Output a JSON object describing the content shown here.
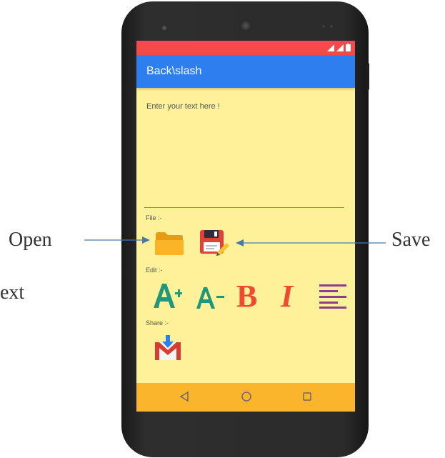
{
  "callouts": {
    "open": "Open",
    "save": "Save",
    "cut_text": "ext"
  },
  "app": {
    "title": "Back\\slash",
    "text_placeholder": "Enter your text here !"
  },
  "sections": {
    "file_label": "File :-",
    "edit_label": "Edit :-",
    "share_label": "Share :-"
  },
  "icons": {
    "file": [
      "open-folder-icon",
      "save-floppy-icon"
    ],
    "edit": [
      "increase-font-size-icon",
      "decrease-font-size-icon",
      "bold-icon",
      "italic-icon",
      "align-text-icon"
    ],
    "share": [
      "gmail-share-icon"
    ],
    "nav": [
      "back-icon",
      "home-icon",
      "recents-icon"
    ]
  },
  "colors": {
    "status_bar": "#f44a4a",
    "app_bar": "#2d7ff0",
    "background": "#fdf199",
    "nav_bar": "#fbb52d",
    "font_size_icons": "#21967a",
    "bold_italic": "#f04a30",
    "align_icon": "#8e3c8e"
  }
}
